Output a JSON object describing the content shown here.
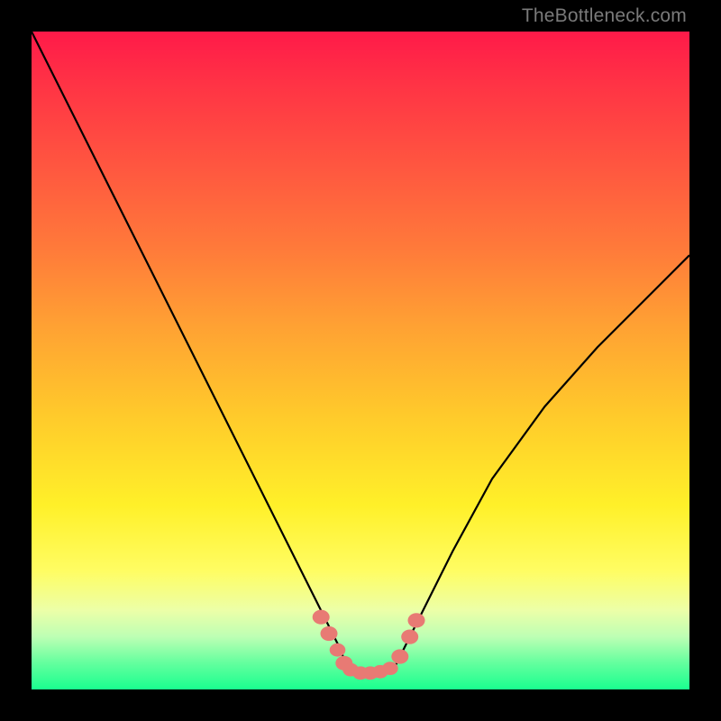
{
  "watermark": "TheBottleneck.com",
  "chart_data": {
    "type": "line",
    "title": "",
    "xlabel": "",
    "ylabel": "",
    "xlim": [
      0,
      100
    ],
    "ylim": [
      0,
      100
    ],
    "grid": false,
    "legend": false,
    "series": [
      {
        "name": "left-curve",
        "x": [
          0,
          6,
          12,
          18,
          24,
          30,
          35,
          40,
          43,
          45,
          47,
          48
        ],
        "values": [
          100,
          88,
          76,
          64,
          52,
          40,
          30,
          20,
          14,
          10,
          6,
          3
        ]
      },
      {
        "name": "right-curve",
        "x": [
          55,
          57,
          60,
          64,
          70,
          78,
          86,
          94,
          100
        ],
        "values": [
          3,
          7,
          13,
          21,
          32,
          43,
          52,
          60,
          66
        ]
      },
      {
        "name": "valley-floor",
        "x": [
          48,
          50,
          52,
          54,
          55
        ],
        "values": [
          3,
          2.5,
          2.5,
          2.7,
          3
        ]
      }
    ],
    "markers": [
      {
        "x": 44.0,
        "y": 11.0,
        "r": 1.3
      },
      {
        "x": 45.2,
        "y": 8.5,
        "r": 1.3
      },
      {
        "x": 46.5,
        "y": 6.0,
        "r": 1.2
      },
      {
        "x": 47.5,
        "y": 4.0,
        "r": 1.3
      },
      {
        "x": 48.5,
        "y": 3.0,
        "r": 1.2
      },
      {
        "x": 50.0,
        "y": 2.5,
        "r": 1.2
      },
      {
        "x": 51.5,
        "y": 2.5,
        "r": 1.2
      },
      {
        "x": 53.0,
        "y": 2.7,
        "r": 1.2
      },
      {
        "x": 54.5,
        "y": 3.2,
        "r": 1.2
      },
      {
        "x": 56.0,
        "y": 5.0,
        "r": 1.3
      },
      {
        "x": 57.5,
        "y": 8.0,
        "r": 1.3
      },
      {
        "x": 58.5,
        "y": 10.5,
        "r": 1.3
      }
    ],
    "background_gradient": {
      "direction": "top-to-bottom",
      "stops": [
        {
          "pos": 0.0,
          "color": "#ff1a49"
        },
        {
          "pos": 0.2,
          "color": "#ff5540"
        },
        {
          "pos": 0.45,
          "color": "#ffa233"
        },
        {
          "pos": 0.72,
          "color": "#fff029"
        },
        {
          "pos": 0.88,
          "color": "#ecffa8"
        },
        {
          "pos": 1.0,
          "color": "#1aff8f"
        }
      ]
    }
  }
}
